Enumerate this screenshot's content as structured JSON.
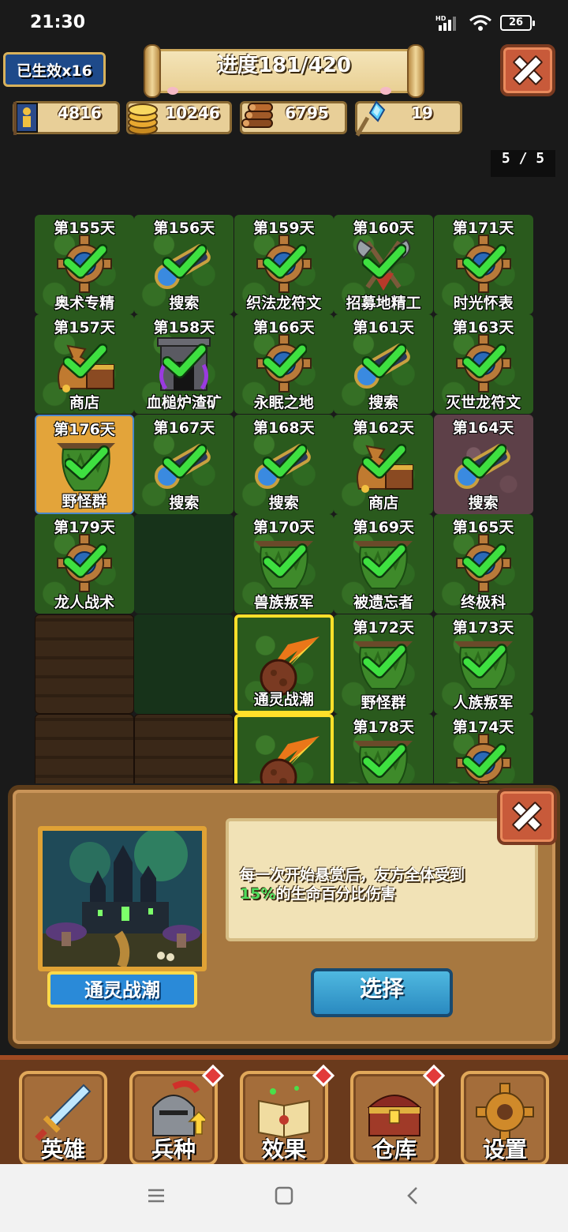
{
  "status_bar": {
    "time": "21:30",
    "battery": "26",
    "network": "HD"
  },
  "header": {
    "effects_badge": "已生效x16",
    "progress_title": "进度181/420"
  },
  "resources": [
    {
      "icon": "troop-icon",
      "value": "4816"
    },
    {
      "icon": "gold-coins-icon",
      "value": "10246"
    },
    {
      "icon": "wood-logs-icon",
      "value": "6795"
    },
    {
      "icon": "crystal-staff-icon",
      "value": "19"
    }
  ],
  "page_indicator": "5 / 5",
  "grid": {
    "rows": [
      [
        {
          "day": "第155天",
          "name": "奥术专精",
          "terrain": "forest",
          "icon": "gear-emblem-icon",
          "done": true
        },
        {
          "day": "第156天",
          "name": "搜索",
          "terrain": "forest",
          "icon": "spyglass-icon",
          "done": true
        },
        {
          "day": "第159天",
          "name": "织法龙符文",
          "terrain": "forest",
          "icon": "gear-emblem-icon",
          "done": true
        },
        {
          "day": "第160天",
          "name": "招募地精工",
          "terrain": "forest",
          "icon": "crossed-axes-icon",
          "done": true
        },
        {
          "day": "第171天",
          "name": "时光怀表",
          "terrain": "forest",
          "icon": "gear-emblem-icon",
          "done": true
        }
      ],
      [
        {
          "day": "第157天",
          "name": "商店",
          "terrain": "forest",
          "icon": "loot-bag-icon",
          "done": true
        },
        {
          "day": "第158天",
          "name": "血槌炉渣矿",
          "terrain": "forest",
          "icon": "mine-icon",
          "done": true
        },
        {
          "day": "第166天",
          "name": "永眠之地",
          "terrain": "forest",
          "icon": "gear-emblem-icon",
          "done": true
        },
        {
          "day": "第161天",
          "name": "搜索",
          "terrain": "forest",
          "icon": "spyglass-icon",
          "done": true
        },
        {
          "day": "第163天",
          "name": "灭世龙符文",
          "terrain": "forest",
          "icon": "gear-emblem-icon",
          "done": true
        }
      ],
      [
        {
          "day": "第176天",
          "name": "野怪群",
          "terrain": "desert",
          "icon": "monster-nest-icon",
          "done": true
        },
        {
          "day": "第167天",
          "name": "搜索",
          "terrain": "forest",
          "icon": "spyglass-icon",
          "done": true
        },
        {
          "day": "第168天",
          "name": "搜索",
          "terrain": "forest",
          "icon": "spyglass-icon",
          "done": true
        },
        {
          "day": "第162天",
          "name": "商店",
          "terrain": "forest",
          "icon": "loot-bag-icon",
          "done": true
        },
        {
          "day": "第164天",
          "name": "搜索",
          "terrain": "rocky",
          "icon": "spyglass-icon",
          "done": true
        }
      ],
      [
        {
          "day": "第179天",
          "name": "龙人战术",
          "terrain": "forest",
          "icon": "gear-emblem-icon",
          "done": true
        },
        {
          "day": "",
          "name": "",
          "terrain": "forest-dark",
          "icon": "",
          "done": false
        },
        {
          "day": "第170天",
          "name": "兽族叛军",
          "terrain": "forest",
          "icon": "monster-nest-icon",
          "done": true
        },
        {
          "day": "第169天",
          "name": "被遗忘者",
          "terrain": "forest",
          "icon": "monster-nest-icon",
          "done": true
        },
        {
          "day": "第165天",
          "name": "终极科",
          "terrain": "forest",
          "icon": "gear-emblem-icon",
          "done": true
        }
      ],
      [
        {
          "day": "",
          "name": "",
          "terrain": "soil",
          "icon": "",
          "done": false
        },
        {
          "day": "",
          "name": "",
          "terrain": "forest-dark",
          "icon": "",
          "done": false
        },
        {
          "day": "",
          "name": "通灵战潮",
          "terrain": "forest",
          "icon": "fire-meteor-icon",
          "done": false,
          "highlight": true
        },
        {
          "day": "第172天",
          "name": "野怪群",
          "terrain": "forest",
          "icon": "monster-nest-icon",
          "done": true
        },
        {
          "day": "第173天",
          "name": "人族叛军",
          "terrain": "forest",
          "icon": "monster-nest-icon",
          "done": true
        }
      ],
      [
        {
          "day": "",
          "name": "",
          "terrain": "soil",
          "icon": "",
          "done": false
        },
        {
          "day": "",
          "name": "",
          "terrain": "soil",
          "icon": "",
          "done": false
        },
        {
          "day": "",
          "name": "",
          "terrain": "forest",
          "icon": "fire-meteor-icon",
          "done": false,
          "highlight": true
        },
        {
          "day": "第178天",
          "name": "",
          "terrain": "forest",
          "icon": "monster-nest-icon",
          "done": true
        },
        {
          "day": "第174天",
          "name": "",
          "terrain": "forest",
          "icon": "gear-emblem-icon",
          "done": true
        }
      ]
    ]
  },
  "detail_panel": {
    "portrait_label": "通灵战潮",
    "description_before": "每一次开始悬赏后，友方全体受到",
    "description_percent": "15%",
    "description_after": "的生命百分比伤害",
    "select_label": "选择"
  },
  "bottom_nav": [
    {
      "label": "英雄",
      "icon": "sword-icon",
      "badge": false
    },
    {
      "label": "兵种",
      "icon": "knight-helmet-icon",
      "badge": true
    },
    {
      "label": "效果",
      "icon": "spellbook-icon",
      "badge": true
    },
    {
      "label": "仓库",
      "icon": "treasure-chest-icon",
      "badge": true
    },
    {
      "label": "设置",
      "icon": "settings-gear-icon",
      "badge": false
    }
  ],
  "colors": {
    "check": "#3ee040",
    "highlight": "#ffe02a",
    "accent_blue": "#2a8ad8"
  }
}
